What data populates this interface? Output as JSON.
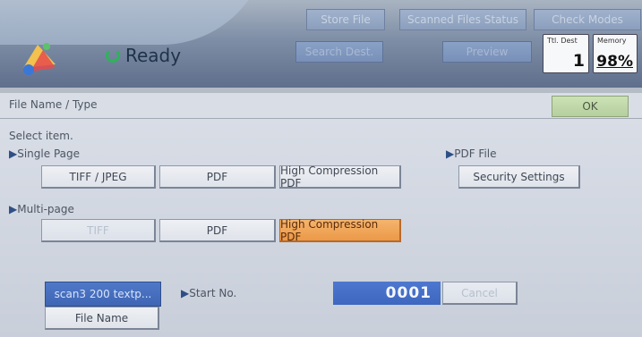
{
  "header": {
    "status": "Ready",
    "top_buttons": [
      "Store File",
      "Scanned Files Status",
      "Check Modes"
    ],
    "mid_buttons": [
      "Search Dest.",
      "Preview"
    ],
    "counters": [
      {
        "label": "Ttl. Dest",
        "value": "1"
      },
      {
        "label": "Memory",
        "value": "98%"
      }
    ]
  },
  "titlebar": {
    "title": "File Name / Type",
    "ok": "OK"
  },
  "main": {
    "select_prompt": "Select item.",
    "single_page": {
      "label": "Single Page",
      "buttons": [
        "TIFF / JPEG",
        "PDF",
        "High Compression PDF"
      ]
    },
    "pdf_file": {
      "label": "PDF File",
      "button": "Security Settings"
    },
    "multi_page": {
      "label": "Multi-page",
      "buttons": [
        "TIFF",
        "PDF",
        "High Compression PDF"
      ],
      "selected": "High Compression PDF"
    },
    "file": {
      "name_value": "scan3 200 textp...",
      "name_button": "File Name"
    },
    "start_no": {
      "label": "Start No.",
      "value": "0001",
      "cancel": "Cancel"
    }
  },
  "colors": {
    "selected": "#eb9947",
    "accent_blue": "#3f66b4",
    "ready_green": "#2db35a"
  }
}
